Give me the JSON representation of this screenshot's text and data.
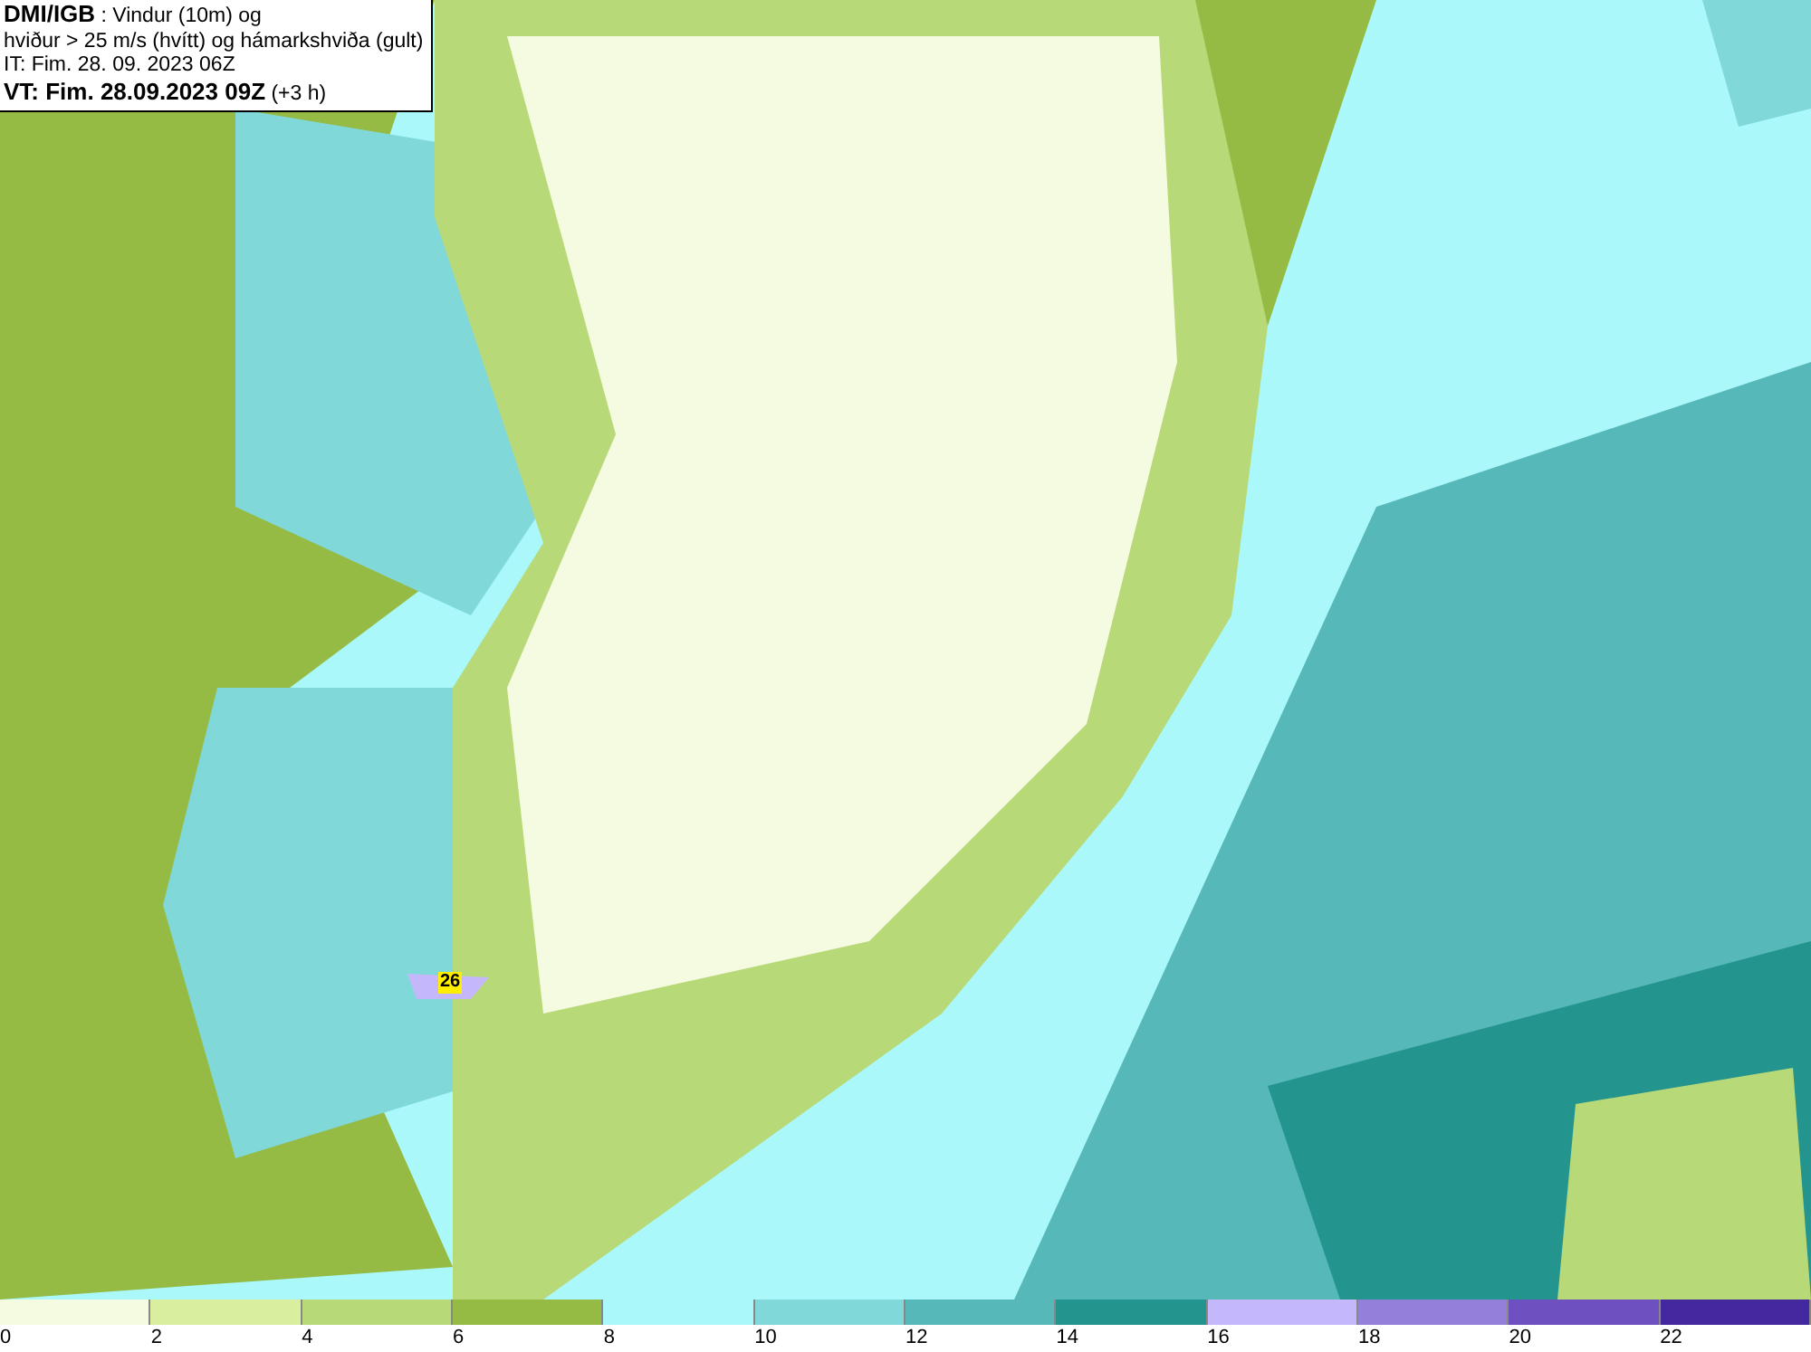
{
  "header": {
    "lines": [
      "**DMI/IGB** : Vindur (10m) og",
      "hviður > 25 m/s (hvítt) og hámarkshviða (gult)",
      "IT: Fim. 28. 09. 2023 06Z",
      "**VT: Fim. 28.09.2023 09Z** (+3 h)"
    ]
  },
  "map": {
    "gust_label": "26"
  },
  "legend": {
    "bins": [
      {
        "label": "0",
        "color": "#f5fbe0"
      },
      {
        "label": "2",
        "color": "#daeea0"
      },
      {
        "label": "4",
        "color": "#b8d978"
      },
      {
        "label": "6",
        "color": "#96bb44"
      },
      {
        "label": "8",
        "color": "#aaf8fa"
      },
      {
        "label": "10",
        "color": "#80d8d8"
      },
      {
        "label": "12",
        "color": "#56b8b8"
      },
      {
        "label": "14",
        "color": "#23948e"
      },
      {
        "label": "16",
        "color": "#c4b8fa"
      },
      {
        "label": "18",
        "color": "#9480da"
      },
      {
        "label": "20",
        "color": "#6e50c0"
      },
      {
        "label": "22",
        "color": "#4428a0"
      }
    ]
  }
}
